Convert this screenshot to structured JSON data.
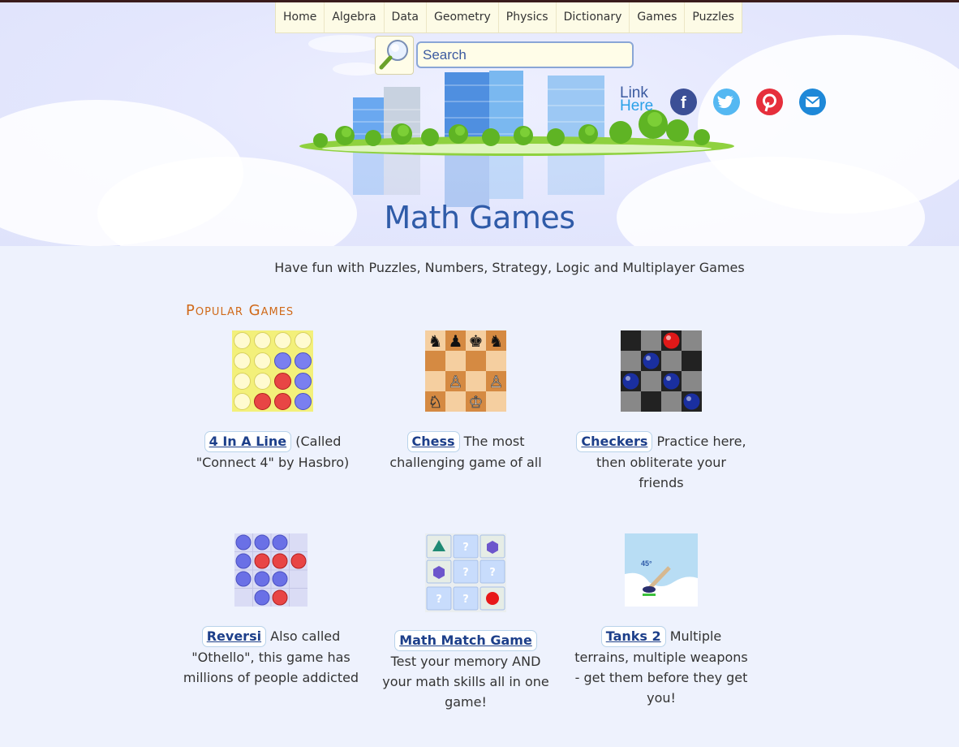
{
  "nav": [
    "Home",
    "Algebra",
    "Data",
    "Geometry",
    "Physics",
    "Dictionary",
    "Games",
    "Puzzles"
  ],
  "search": {
    "placeholder": "Search"
  },
  "header": {
    "title": "Math Games",
    "link_line1": "Link",
    "link_line2": "Here"
  },
  "social": [
    "facebook-icon",
    "twitter-icon",
    "pinterest-icon",
    "email-icon"
  ],
  "subtitle": "Have fun with Puzzles, Numbers, Strategy, Logic and Multiplayer Games",
  "section_title": "Popular Games",
  "games": [
    {
      "name": "4 In A Line",
      "desc": "(Called \"Connect 4\" by Hasbro)"
    },
    {
      "name": "Chess",
      "desc": "The most challenging game of all"
    },
    {
      "name": "Checkers",
      "desc": "Practice here, then obliterate your friends"
    },
    {
      "name": "Reversi",
      "desc": "Also called \"Othello\", this game has millions of people addicted"
    },
    {
      "name": "Math Match Game",
      "desc": "Test your memory AND your math skills all in one game!"
    },
    {
      "name": "Tanks 2",
      "desc": "Multiple terrains, multiple weapons - get them before they get you!"
    }
  ],
  "tanks_angle": "45°",
  "colors": {
    "title_blue": "#2f5ba8",
    "section_orange": "#d06a1a",
    "link_blue": "#1d3f8a"
  }
}
